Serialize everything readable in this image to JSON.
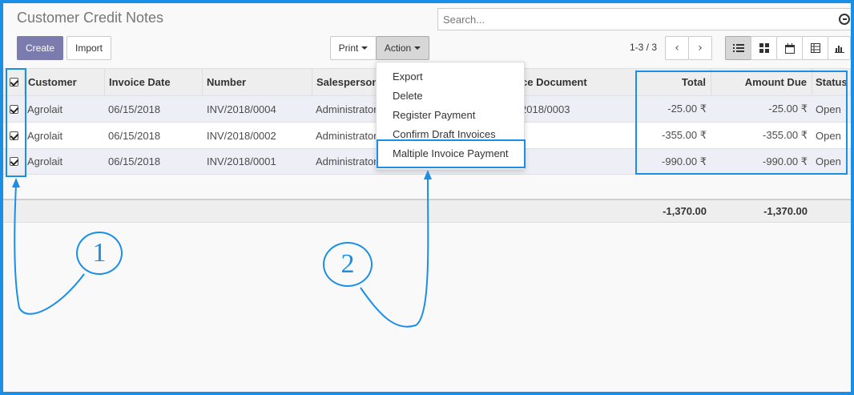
{
  "page": {
    "title": "Customer Credit Notes"
  },
  "search": {
    "placeholder": "Search..."
  },
  "toolbar": {
    "create": "Create",
    "import": "Import",
    "print": "Print",
    "action": "Action"
  },
  "pager": {
    "text": "1-3 / 3"
  },
  "columns": {
    "customer": "Customer",
    "invoice_date": "Invoice Date",
    "number": "Number",
    "salesperson": "Salesperson",
    "source": "rce Document",
    "total": "Total",
    "amount_due": "Amount Due",
    "status": "Status"
  },
  "rows": [
    {
      "customer": "Agrolait",
      "date": "06/15/2018",
      "number": "INV/2018/0004",
      "salesperson": "Administrator",
      "source": "2018/0003",
      "total": "-25.00 ₹",
      "amount_due": "-25.00 ₹",
      "status": "Open"
    },
    {
      "customer": "Agrolait",
      "date": "06/15/2018",
      "number": "INV/2018/0002",
      "salesperson": "Administrator",
      "source": "",
      "total": "-355.00 ₹",
      "amount_due": "-355.00 ₹",
      "status": "Open"
    },
    {
      "customer": "Agrolait",
      "date": "06/15/2018",
      "number": "INV/2018/0001",
      "salesperson": "Administrator",
      "source": "",
      "total": "-990.00 ₹",
      "amount_due": "-990.00 ₹",
      "status": "Open"
    }
  ],
  "totals": {
    "total": "-1,370.00",
    "amount_due": "-1,370.00"
  },
  "action_menu": [
    "Export",
    "Delete",
    "Register Payment",
    "Confirm Draft Invoices",
    "Maltiple Invoice Payment"
  ],
  "annotations": {
    "one": "1",
    "two": "2"
  },
  "colors": {
    "accent": "#1b8fe6",
    "primary": "#7c7bad"
  }
}
